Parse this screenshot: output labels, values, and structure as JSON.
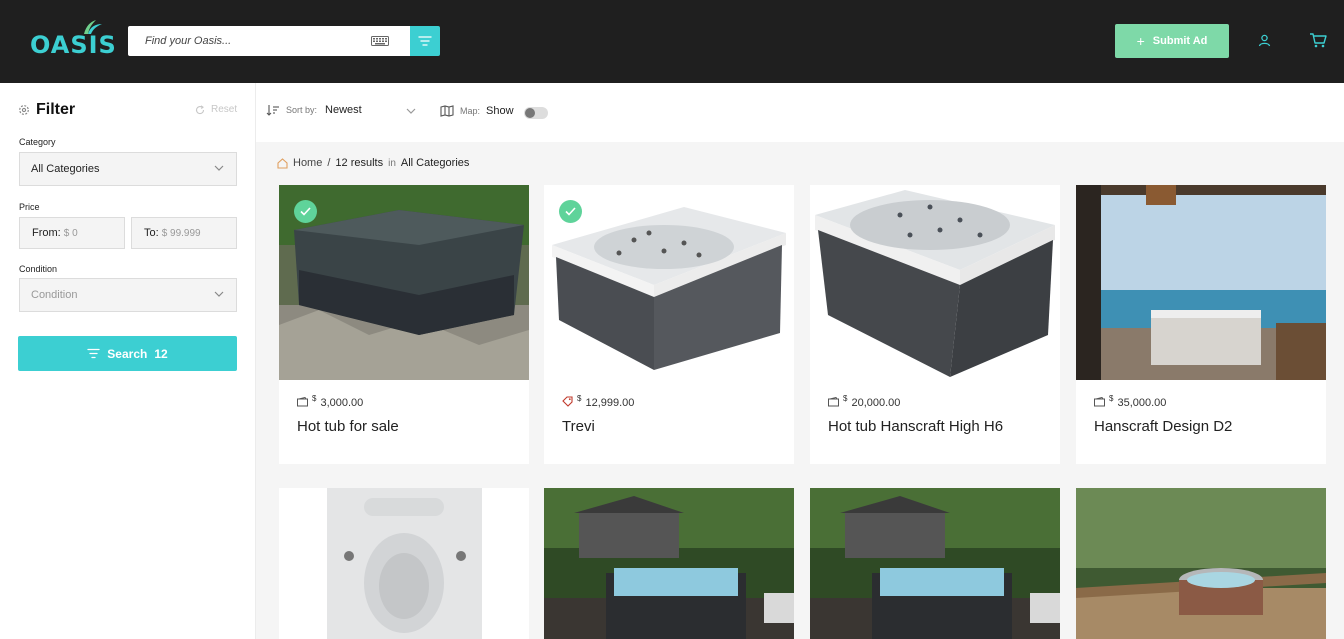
{
  "header": {
    "logo_text": "OASIS",
    "search_placeholder": "Find your Oasis...",
    "submit_label": "Submit Ad"
  },
  "sidebar": {
    "title": "Filter",
    "reset_label": "Reset",
    "category_label": "Category",
    "category_value": "All Categories",
    "price_label": "Price",
    "from_label": "From:",
    "from_value": "$ 0",
    "to_label": "To:",
    "to_value": "$ 99.999",
    "condition_label": "Condition",
    "condition_value": "Condition",
    "search_label": "Search",
    "search_count": "12"
  },
  "topbar": {
    "sort_label": "Sort by:",
    "sort_value": "Newest",
    "map_label": "Map:",
    "map_value": "Show"
  },
  "breadcrumb": {
    "home": "Home",
    "sep": "/",
    "results": "12 results",
    "in": "in",
    "category": "All Categories"
  },
  "listings": [
    {
      "currency": "$",
      "price": "3,000.00",
      "title": "Hot tub for sale",
      "verified": true,
      "price_icon": "wallet-icon"
    },
    {
      "currency": "$",
      "price": "12,999.00",
      "title": "Trevi",
      "verified": true,
      "price_icon": "tag-icon"
    },
    {
      "currency": "$",
      "price": "20,000.00",
      "title": "Hot tub Hanscraft High H6",
      "verified": false,
      "price_icon": "wallet-icon"
    },
    {
      "currency": "$",
      "price": "35,000.00",
      "title": "Hanscraft Design D2",
      "verified": false,
      "price_icon": "wallet-icon"
    }
  ],
  "colors": {
    "accent": "#3ccfd2",
    "submit": "#7ed9a8",
    "header_bg": "#1f1f1f",
    "verified": "#5fd39a"
  }
}
